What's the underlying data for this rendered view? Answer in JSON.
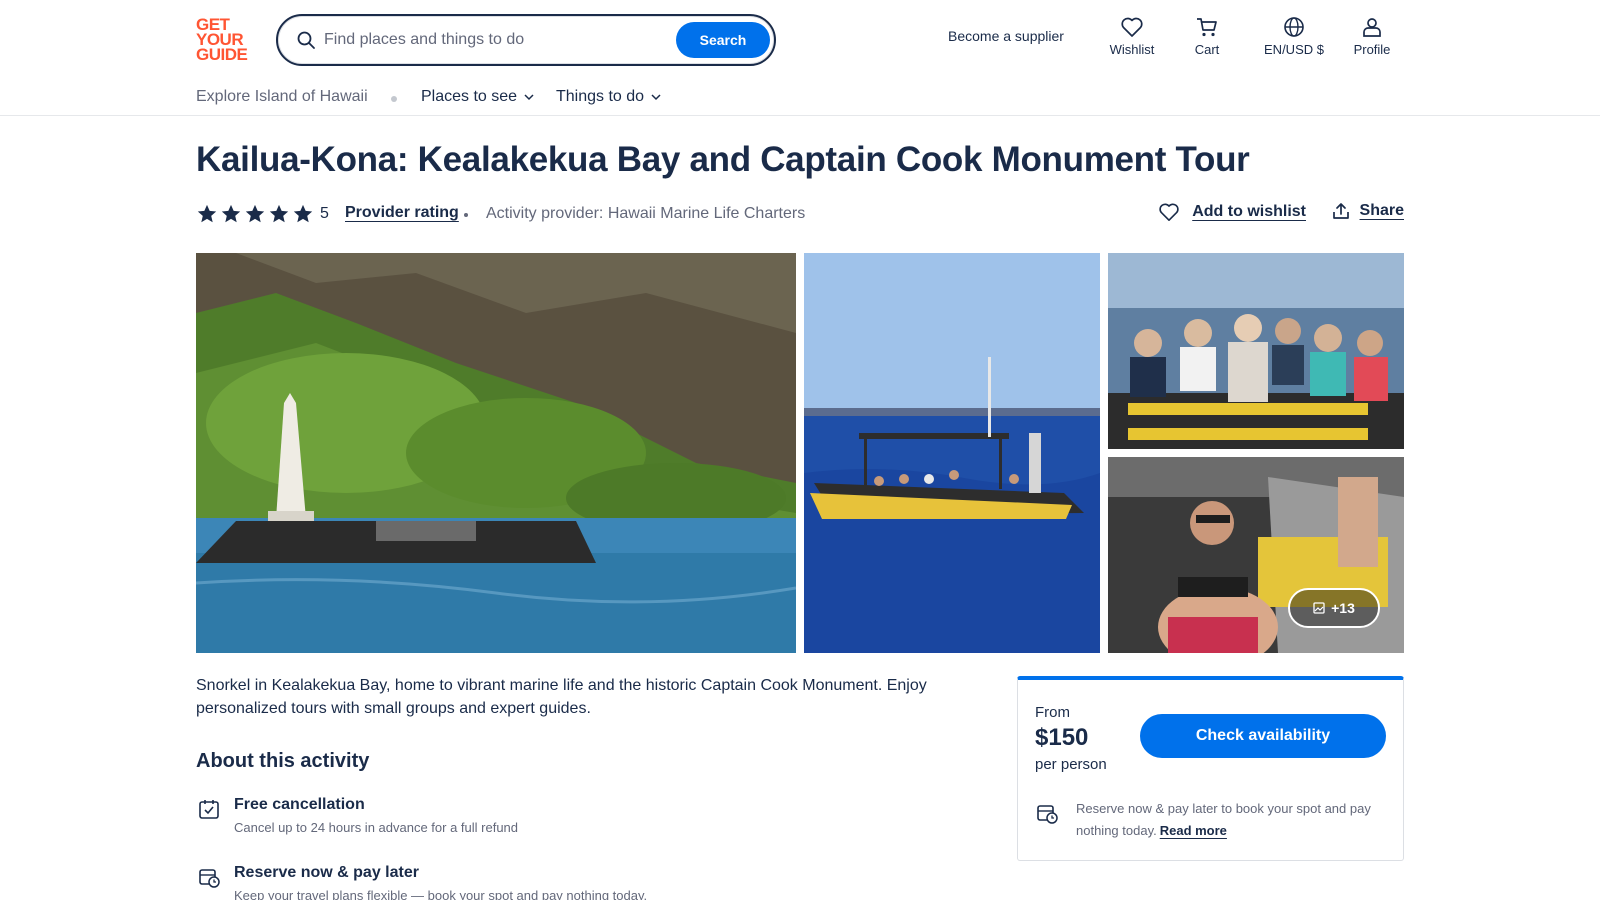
{
  "header": {
    "logo_lines": [
      "GET",
      "YOUR",
      "GUIDE"
    ],
    "search_placeholder": "Find places and things to do",
    "search_button": "Search",
    "become_supplier": "Become a supplier",
    "wishlist": "Wishlist",
    "cart": "Cart",
    "locale": "EN/USD $",
    "profile": "Profile"
  },
  "subnav": {
    "breadcrumb": "Explore Island of Hawaii",
    "places": "Places to see",
    "things": "Things to do"
  },
  "activity": {
    "title": "Kailua-Kona: Kealakekua Bay and Captain Cook Monument Tour",
    "rating": "5",
    "provider_rating_label": "Provider rating",
    "provider": "Activity provider: Hawaii Marine Life Charters",
    "add_wishlist": "Add to wishlist",
    "share": "Share",
    "more_photos": "+13",
    "description": "Snorkel in Kealakekua Bay, home to vibrant marine life and the historic Captain Cook Monument. Enjoy personalized tours with small groups and expert guides.",
    "about_title": "About this activity",
    "features": [
      {
        "title": "Free cancellation",
        "subtitle": "Cancel up to 24 hours in advance for a full refund"
      },
      {
        "title": "Reserve now & pay later",
        "subtitle": "Keep your travel plans flexible — book your spot and pay nothing today."
      }
    ]
  },
  "booking": {
    "from": "From",
    "price": "$150",
    "per": "per person",
    "check_availability": "Check availability",
    "note": "Reserve now & pay later to book your spot and pay nothing today.",
    "read_more": "Read more"
  },
  "colors": {
    "brand": "#ff5533",
    "primary": "#0071eb",
    "text": "#1a2b49",
    "muted": "#63687a"
  }
}
